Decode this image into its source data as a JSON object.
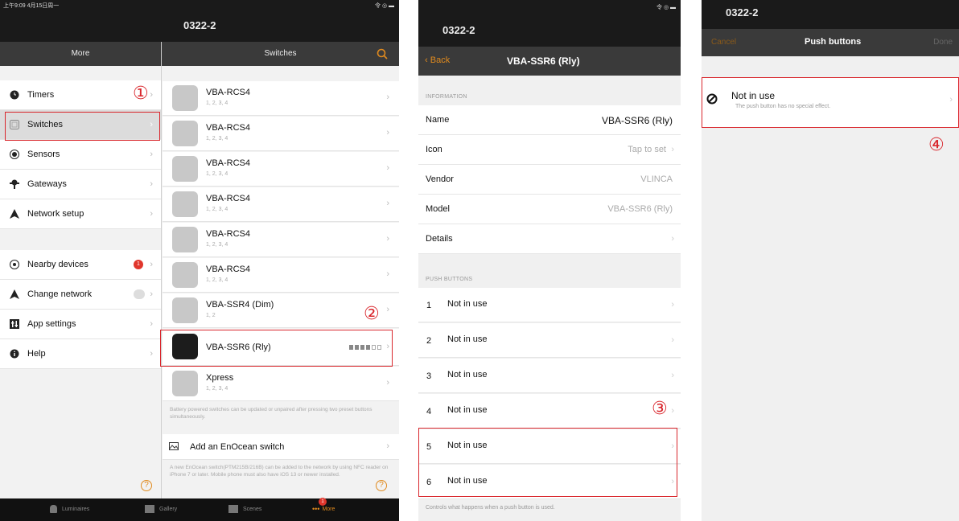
{
  "frame1": {
    "statusbar_left": "上午9:09  4月15日周一",
    "statusbar_right": "令 ◎ ▬",
    "device_title": "0322-2",
    "left_nav_title": "More",
    "right_nav_title": "Switches",
    "menu": [
      {
        "label": "Timers",
        "icon": "clock-icon"
      },
      {
        "label": "Switches",
        "icon": "switch-icon"
      },
      {
        "label": "Sensors",
        "icon": "sensor-icon"
      },
      {
        "label": "Gateways",
        "icon": "gateway-icon"
      },
      {
        "label": "Network setup",
        "icon": "network-icon"
      },
      {
        "label": "Nearby devices",
        "icon": "nearby-icon",
        "badge": "1"
      },
      {
        "label": "Change network",
        "icon": "network-icon"
      },
      {
        "label": "App settings",
        "icon": "settings-icon"
      },
      {
        "label": "Help",
        "icon": "help-icon"
      }
    ],
    "switches": [
      {
        "name": "VBA-RCS4",
        "sub": "1, 2, 3, 4"
      },
      {
        "name": "VBA-RCS4",
        "sub": "1, 2, 3, 4"
      },
      {
        "name": "VBA-RCS4",
        "sub": "1, 2, 3, 4"
      },
      {
        "name": "VBA-RCS4",
        "sub": "1, 2, 3, 4"
      },
      {
        "name": "VBA-RCS4",
        "sub": "1, 2, 3, 4"
      },
      {
        "name": "VBA-RCS4",
        "sub": "1, 2, 3, 4"
      },
      {
        "name": "VBA-SSR4 (Dim)",
        "sub": "1, 2"
      },
      {
        "name": "VBA-SSR6 (Rly)",
        "sub": ""
      },
      {
        "name": "Xpress",
        "sub": "1, 2, 3, 4"
      }
    ],
    "battery_note": "Battery powered switches can be updated or unpaired after pressing two preset buttons simultaneously.",
    "add_switch_label": "Add an EnOcean switch",
    "add_switch_note": "A new EnOcean switch(PTM215B/216B) can be added to the network by using NFC reader on iPhone 7 or later. Mobile phone must also have iOS 13 or newer installed.",
    "tabs": [
      {
        "label": "Luminaires"
      },
      {
        "label": "Gallery"
      },
      {
        "label": "Scenes"
      },
      {
        "label": "More",
        "badge": "1"
      }
    ],
    "marker1": "①",
    "marker2": "②"
  },
  "frame2": {
    "device_title": "0322-2",
    "back_label": "Back",
    "nav_title": "VBA-SSR6 (Rly)",
    "info_header": "INFORMATION",
    "info_rows": [
      {
        "label": "Name",
        "value": "VBA-SSR6 (Rly)"
      },
      {
        "label": "Icon",
        "value": "Tap to set"
      },
      {
        "label": "Vendor",
        "value": "VLINCA"
      },
      {
        "label": "Model",
        "value": "VBA-SSR6 (Rly)"
      },
      {
        "label": "Details",
        "value": ""
      }
    ],
    "push_header": "PUSH BUTTONS",
    "push_rows": [
      {
        "num": "1",
        "label": "Not in use"
      },
      {
        "num": "2",
        "label": "Not in use"
      },
      {
        "num": "3",
        "label": "Not in use"
      },
      {
        "num": "4",
        "label": "Not in use"
      },
      {
        "num": "5",
        "label": "Not in use"
      },
      {
        "num": "6",
        "label": "Not in use"
      }
    ],
    "footer_note": "Controls what happens when a push button is used.",
    "marker3": "③"
  },
  "frame3": {
    "device_title": "0322-2",
    "cancel_label": "Cancel",
    "nav_title": "Push buttons",
    "done_label": "Done",
    "option_title": "Not in use",
    "option_desc": "The push button has no special effect.",
    "marker4": "④"
  },
  "colors": {
    "accent": "#e08a1e",
    "marker_red": "#d9262c",
    "badge_red": "#e0362c"
  }
}
